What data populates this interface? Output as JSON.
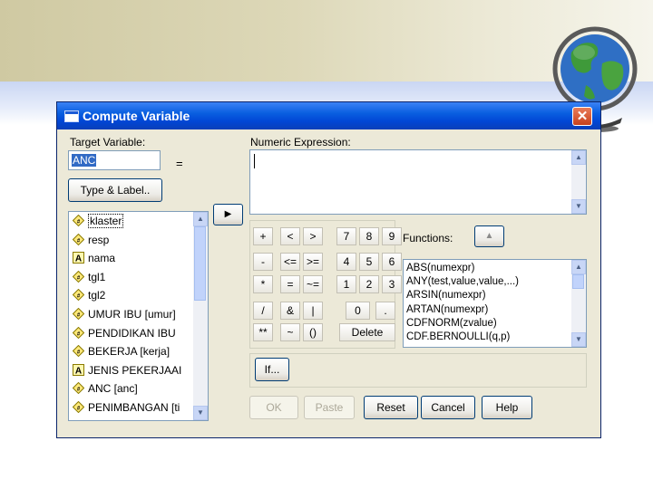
{
  "dialog": {
    "title": "Compute Variable",
    "close_glyph": "✕"
  },
  "target": {
    "label": "Target Variable:",
    "value": "ANC",
    "equals": "=",
    "type_label_button": "Type & Label.."
  },
  "expression": {
    "label": "Numeric Expression:",
    "value": ""
  },
  "move_button_glyph": "▶",
  "variables": [
    {
      "label": "klaster",
      "icon": "scale-variable-icon",
      "selected": true
    },
    {
      "label": "resp",
      "icon": "scale-variable-icon"
    },
    {
      "label": "nama",
      "icon": "string-variable-icon"
    },
    {
      "label": "tgl1",
      "icon": "scale-variable-icon"
    },
    {
      "label": "tgl2",
      "icon": "scale-variable-icon"
    },
    {
      "label": "UMUR IBU [umur]",
      "icon": "scale-variable-icon"
    },
    {
      "label": "PENDIDIKAN IBU",
      "icon": "scale-variable-icon"
    },
    {
      "label": "BEKERJA [kerja]",
      "icon": "scale-variable-icon"
    },
    {
      "label": "JENIS PEKERJAAI",
      "icon": "string-variable-icon"
    },
    {
      "label": "ANC [anc]",
      "icon": "scale-variable-icon"
    },
    {
      "label": "PENIMBANGAN [ti",
      "icon": "scale-variable-icon"
    }
  ],
  "keypad": {
    "row1": [
      "+",
      "<",
      ">",
      "7",
      "8",
      "9"
    ],
    "row2": [
      "-",
      "<=",
      ">=",
      "4",
      "5",
      "6"
    ],
    "row3": [
      "*",
      "=",
      "~=",
      "1",
      "2",
      "3"
    ],
    "row4": [
      "/",
      "&",
      "|",
      "0",
      "."
    ],
    "row5": [
      "**",
      "~",
      "()"
    ],
    "delete": "Delete"
  },
  "functions": {
    "label": "Functions:",
    "up_glyph": "▲",
    "items": [
      "ABS(numexpr)",
      "ANY(test,value,value,...)",
      "ARSIN(numexpr)",
      "ARTAN(numexpr)",
      "CDFNORM(zvalue)",
      "CDF.BERNOULLI(q,p)"
    ]
  },
  "if_button": "If...",
  "actions": {
    "ok": "OK",
    "paste": "Paste",
    "reset": "Reset",
    "cancel": "Cancel",
    "help": "Help"
  },
  "colors": {
    "titlebar": "#0a5fe0",
    "dialog_bg": "#ece9d8",
    "selection": "#316ac5",
    "close": "#d24f2a"
  }
}
